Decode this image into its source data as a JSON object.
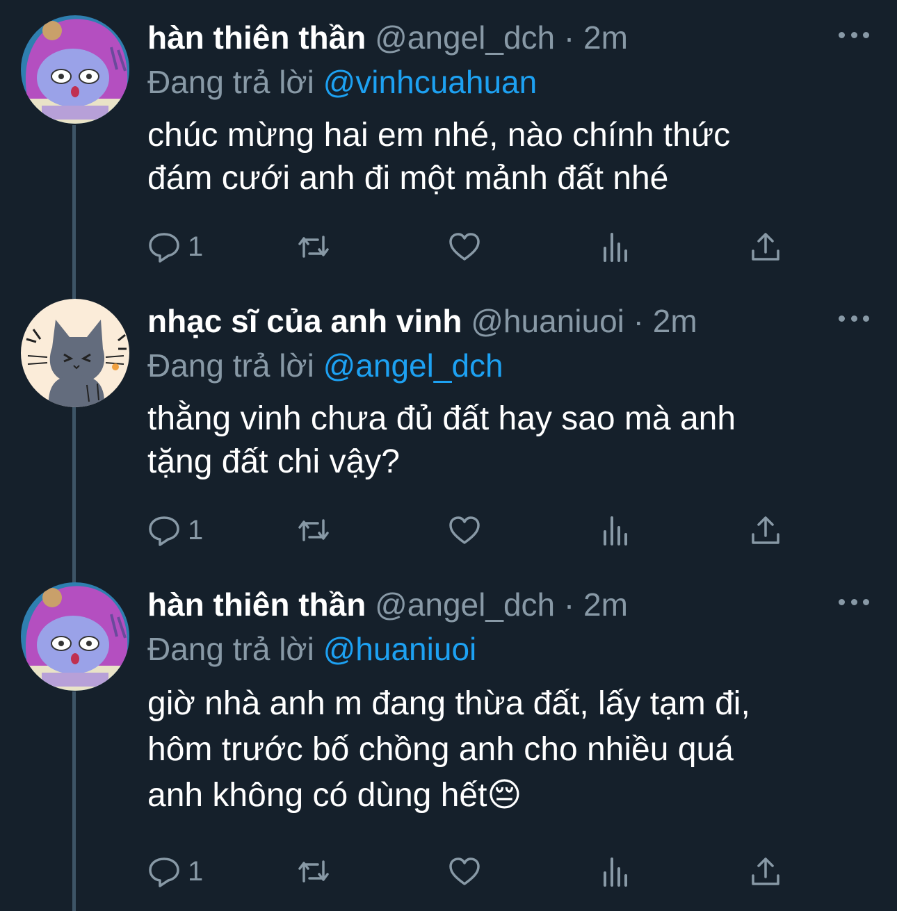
{
  "tweets": [
    {
      "name": "hàn thiên thần",
      "handle": "@angel_dch",
      "separator": "·",
      "time": "2m",
      "reply_prefix": "Đang trả lời",
      "reply_to": "@vinhcuahuan",
      "text_line1": "chúc mừng hai em nhé, nào chính thức",
      "text_line2": "đám cưới anh đi một mảnh đất nhé",
      "reply_count": "1",
      "avatar": "pink-hood-character-avatar"
    },
    {
      "name": "nhạc sĩ của anh vinh",
      "handle": "@huaniuoi",
      "separator": "·",
      "time": "2m",
      "reply_prefix": "Đang trả lời",
      "reply_to": "@angel_dch",
      "text_line1": "thằng vinh chưa đủ đất hay sao mà anh",
      "text_line2": "tặng đất chi vậy?",
      "reply_count": "1",
      "avatar": "gray-cat-avatar"
    },
    {
      "name": "hàn thiên thần",
      "handle": "@angel_dch",
      "separator": "·",
      "time": "2m",
      "reply_prefix": "Đang trả lời",
      "reply_to": "@huaniuoi",
      "text_line1": "giờ nhà anh m đang thừa đất, lấy tạm đi,",
      "text_line2": "hôm trước bố chồng anh cho nhiều quá",
      "text_line3": "anh không có dùng hết😔",
      "reply_count": "1",
      "avatar": "pink-hood-character-avatar"
    }
  ],
  "icons": {
    "reply": "reply-icon",
    "retweet": "retweet-icon",
    "like": "heart-icon",
    "analytics": "analytics-icon",
    "share": "share-icon",
    "more": "more-icon"
  },
  "colors": {
    "background": "#15202b",
    "secondary_text": "#8899a6",
    "mention": "#1da1f2",
    "thread_line": "#3d5466"
  }
}
